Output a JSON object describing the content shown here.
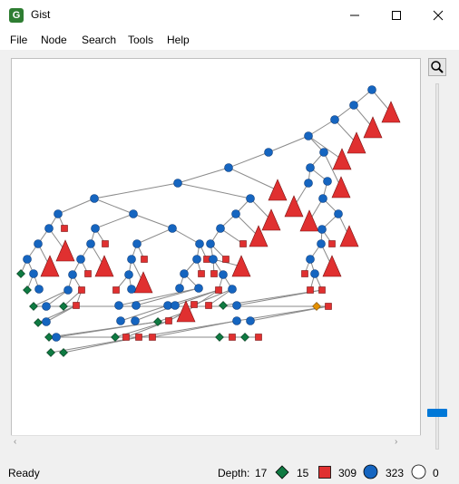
{
  "window": {
    "title": "Gist",
    "app_icon_letter": "G"
  },
  "menu": {
    "items": [
      "File",
      "Node",
      "Search",
      "Tools",
      "Help"
    ]
  },
  "status": {
    "text": "Ready",
    "depth_label": "Depth:",
    "depth_value": "17",
    "solved_count": "15",
    "failed_count": "309",
    "choice_count": "323",
    "open_count": "0"
  },
  "colors": {
    "choice_node": "#1565c0",
    "failed_node": "#e03030",
    "solved_node": "#0f7a42",
    "branch_solution": "#e39000",
    "edge": "#8a8a8a",
    "slider": "#0078d7"
  },
  "icons": {
    "zoom": "magnifier-icon",
    "minimize": "minimize-icon",
    "maximize": "maximize-icon",
    "close": "close-icon"
  }
}
